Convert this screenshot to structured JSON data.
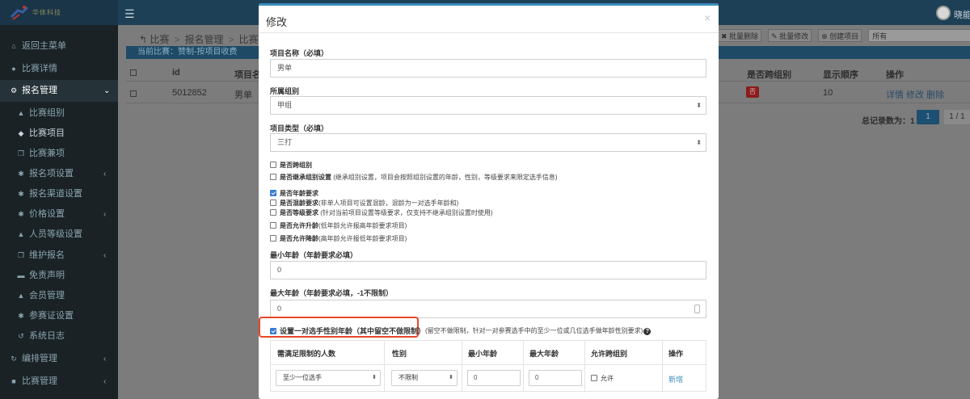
{
  "header": {
    "brand": "华体科技",
    "user_name": "晓能"
  },
  "sidebar": {
    "items": [
      {
        "label": "返回主菜单",
        "icon": "home-icon"
      },
      {
        "label": "比赛详情",
        "icon": "info-icon"
      },
      {
        "label": "报名管理",
        "icon": "cogs-icon"
      },
      {
        "label": "比赛组别",
        "icon": "user-icon"
      },
      {
        "label": "比赛项目",
        "icon": "binoculars-icon"
      },
      {
        "label": "比赛兼项",
        "icon": "copy-icon"
      },
      {
        "label": "报名项设置",
        "icon": "gear-icon"
      },
      {
        "label": "报名渠道设置",
        "icon": "gear-icon"
      },
      {
        "label": "价格设置",
        "icon": "gear-icon"
      },
      {
        "label": "人员等级设置",
        "icon": "user-icon"
      },
      {
        "label": "维护报名",
        "icon": "copy-icon"
      },
      {
        "label": "免责声明",
        "icon": "card-icon"
      },
      {
        "label": "会员管理",
        "icon": "user-icon"
      },
      {
        "label": "参赛证设置",
        "icon": "gear-icon"
      },
      {
        "label": "系统日志",
        "icon": "history-icon"
      },
      {
        "label": "编排管理",
        "icon": "refresh-icon"
      },
      {
        "label": "比赛管理",
        "icon": "trophy-icon"
      }
    ]
  },
  "breadcrumb": {
    "root": "比赛",
    "level1": "报名管理",
    "level2": "比赛项目"
  },
  "current_match": "当前比赛：赞制-按项目收费",
  "toolbar": {
    "batch_delete": "批量删除",
    "batch_edit": "批量修改",
    "create_item": "创建项目",
    "filter_value": "所有"
  },
  "table": {
    "columns": [
      "id",
      "项目名",
      "是否跨组别",
      "显示顺序",
      "操作"
    ],
    "row": {
      "id": "5012852",
      "name": "男单",
      "cross_group": "否",
      "order": "10",
      "actions": "详情 修改 删除"
    },
    "total_label": "总记录数为：1",
    "page": "1",
    "page_count": "1 / 1"
  },
  "modal": {
    "title": "修改",
    "close": "×",
    "name_label": "项目名称（必填）",
    "name_value": "男单",
    "group_label": "所属组别",
    "group_value": "甲组",
    "type_label": "项目类型（必填）",
    "type_value": "三打",
    "checks": [
      {
        "label": "是否跨组别",
        "desc": "",
        "checked": false
      },
      {
        "label": "是否继承组别设置",
        "desc": " (继承组别设置，项目会按照组别设置的年龄，性别，等级要求来限定选手信息)",
        "checked": false
      },
      {
        "label": "是否年龄要求",
        "desc": "",
        "checked": true
      },
      {
        "label": "是否混龄要求",
        "desc": "(非单人项目可设置混龄，混龄为一对选手年龄和)",
        "checked": false
      },
      {
        "label": "是否等级要求",
        "desc": " (针对当前项目设置等级要求，仅支持不继承组别设置时使用)",
        "checked": false
      },
      {
        "label": "是否允许升龄",
        "desc": "(低年龄允许报高年龄要求项目)",
        "checked": false
      },
      {
        "label": "是否允许降龄",
        "desc": "(高年龄允许报低年龄要求项目)",
        "checked": false
      }
    ],
    "min_age_label": "最小年龄（年龄要求必填）",
    "min_age_value": "0",
    "max_age_label": "最大年龄（年龄要求必填，-1不限制）",
    "max_age_value": "0",
    "pair_gender_age": {
      "label": "设置一对选手性别年龄（其中留空不做限制）",
      "checked": true,
      "desc": "(留空不做限制，针对一对参赛选手中的至少一位或几位选手做年龄性别要求)"
    },
    "sub_table": {
      "headers": [
        "需满足限制的人数",
        "性别",
        "最小年龄",
        "最大年龄",
        "允许跨组别",
        "操作"
      ],
      "count_value": "至少一位选手",
      "gender_value": "不限制",
      "min_age": "0",
      "max_age": "0",
      "allow_label": "允许",
      "add_link": "新增"
    }
  }
}
